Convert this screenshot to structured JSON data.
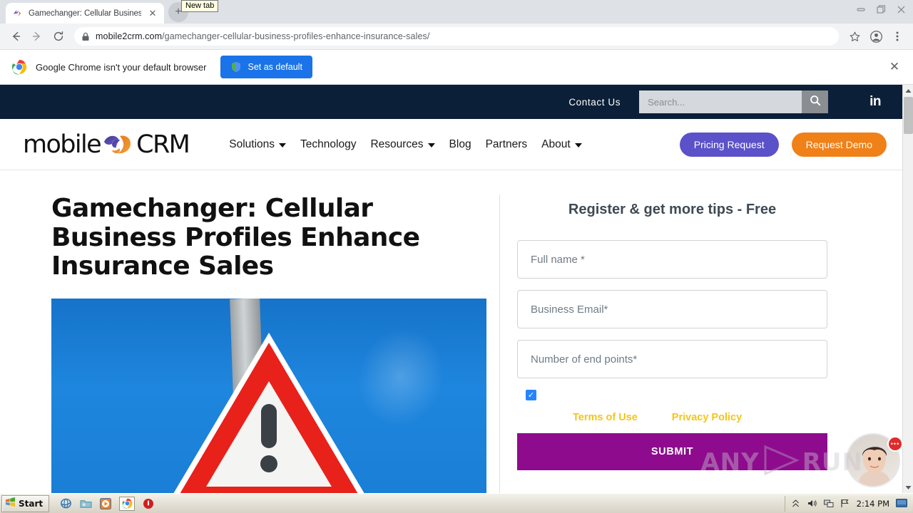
{
  "browser": {
    "tab": {
      "title": "Gamechanger: Cellular Business Prof",
      "close_label": "✕",
      "favicon_name": "site-favicon"
    },
    "newtab_tooltip": "New tab",
    "newtab_plus": "+",
    "window_controls": {
      "minimize": "minimize",
      "restore": "restore",
      "close": "close"
    },
    "toolbar": {
      "back": "back",
      "forward": "forward",
      "reload": "reload",
      "url_host": "mobile2crm.com",
      "url_path": "/gamechanger-cellular-business-profiles-enhance-insurance-sales/",
      "bookmark": "bookmark",
      "profile": "profile",
      "menu": "menu"
    },
    "infobar": {
      "message": "Google Chrome isn't your default browser",
      "button_label": "Set as default",
      "close_label": "✕"
    }
  },
  "site": {
    "topbar": {
      "contact_label": "Contact Us",
      "search_placeholder": "Search...",
      "search_value": "",
      "linkedin_label": "in"
    },
    "header": {
      "logo_left": "mobile",
      "logo_right": "CRM",
      "nav": [
        {
          "label": "Solutions",
          "has_caret": true
        },
        {
          "label": "Technology",
          "has_caret": false
        },
        {
          "label": "Resources",
          "has_caret": true
        },
        {
          "label": "Blog",
          "has_caret": false
        },
        {
          "label": "Partners",
          "has_caret": false
        },
        {
          "label": "About",
          "has_caret": true
        }
      ],
      "pricing_button": "Pricing Request",
      "demo_button": "Request Demo"
    },
    "article": {
      "title": "Gamechanger: Cellular Business Profiles Enhance Insurance Sales",
      "hero_image_alt": "red warning triangle road sign with exclamation mark against blue sky"
    },
    "form": {
      "title": "Register & get more tips - Free",
      "fields": [
        {
          "placeholder": "Full name *",
          "value": ""
        },
        {
          "placeholder": "Business Email*",
          "value": ""
        },
        {
          "placeholder": "Number of end points*",
          "value": ""
        }
      ],
      "consent_checked": true,
      "checkmark": "✓",
      "terms_label": "Terms of Use",
      "privacy_label": "Privacy Policy",
      "submit_label": "SUBMIT"
    },
    "chat_widget": {
      "badge_text": "•••",
      "avatar_name": "support-agent-avatar"
    },
    "watermark": {
      "text_left": "ANY",
      "text_right": "RUN"
    }
  },
  "taskbar": {
    "start_label": "Start",
    "quick_launch": [
      {
        "name": "internet-explorer-icon"
      },
      {
        "name": "folder-icon"
      },
      {
        "name": "media-player-icon"
      },
      {
        "name": "chrome-icon"
      },
      {
        "name": "stop-icon"
      }
    ],
    "tray": {
      "time": "2:14 PM"
    }
  },
  "colors": {
    "topbar_navy": "#0b1f38",
    "pricing_purple": "#5b51c9",
    "demo_orange": "#f08018",
    "submit_purple": "#8e0b8e",
    "link_yellow": "#f5c518",
    "chrome_blue": "#1a73e8"
  }
}
